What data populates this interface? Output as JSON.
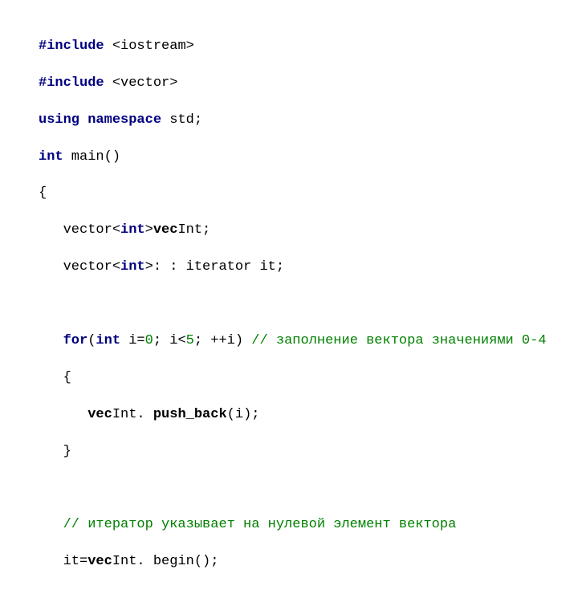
{
  "code": {
    "l1": {
      "a": "#include",
      "b": " <iostream>"
    },
    "l2": {
      "a": "#include",
      "b": " <vector>"
    },
    "l3": {
      "a": "using",
      "b": " namespace",
      "c": " std;"
    },
    "l4": {
      "a": "int",
      "b": " main()"
    },
    "l5": "{",
    "l6": {
      "pad": "   ",
      "a": "vector<",
      "b": "int",
      "c": ">",
      "d": "vec",
      "e": "Int;"
    },
    "l7": {
      "pad": "   ",
      "a": "vector<",
      "b": "int",
      "c": ">",
      "d": ": : iterator it;"
    },
    "l8": "",
    "l9": {
      "pad": "   ",
      "a": "for",
      "b": "(",
      "c": "int",
      "d": " i=",
      "e": "0",
      "f": "; i<",
      "g": "5",
      "h": "; ++i) ",
      "i": "// заполнение вектора значениями 0-4"
    },
    "l10": {
      "pad": "   ",
      "a": "{"
    },
    "l11": {
      "pad": "      ",
      "a": "vec",
      "b": "Int. ",
      "c": "push_back",
      "d": "(i);"
    },
    "l12": {
      "pad": "   ",
      "a": "}"
    },
    "l13": "",
    "l14": {
      "pad": "   ",
      "a": "// итератор указывает на нулевой элемент вектора"
    },
    "l15": {
      "pad": "   ",
      "a": "it=",
      "b": "vec",
      "c": "Int. begin();"
    }
  }
}
